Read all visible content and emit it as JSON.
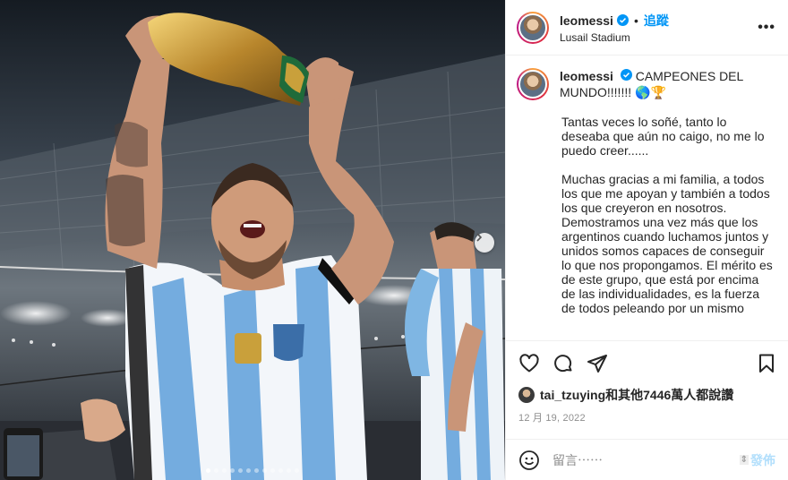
{
  "post": {
    "username": "leomessi",
    "follow_label": "追蹤",
    "separator": "•",
    "location": "Lusail Stadium",
    "more_label": "•••"
  },
  "caption": {
    "username": "leomessi",
    "first_line": "CAMPEONES DEL MUNDO!!!!!!!",
    "emojis": "🌎🏆",
    "paragraphs": [
      "Tantas veces lo soñé, tanto lo deseaba que aún no caigo, no me lo puedo creer......",
      "Muchas gracias a mi familia, a todos los que me apoyan y también a todos los que creyeron en nosotros. Demostramos una vez más que los argentinos cuando luchamos juntos y unidos somos capaces de conseguir lo que nos propongamos. El mérito es de este grupo, que está por encima de las individualidades, es la fuerza de todos peleando por un mismo"
    ]
  },
  "likes": {
    "liker": "tai_tzuying",
    "rest": "和其他7446萬人都說讚"
  },
  "date": "12 月 19, 2022",
  "comment": {
    "placeholder": "留言⋯⋯",
    "post_label": "發佈"
  },
  "icons": [
    "verified-icon",
    "more-icon",
    "heart-icon",
    "comment-icon",
    "share-icon",
    "save-icon",
    "emoji-icon",
    "chevron-right-icon"
  ],
  "colors": {
    "accent": "#0095f6",
    "verified": "#0095f6",
    "post_disabled": "#b2dffc",
    "text": "#262626",
    "muted": "#8e8e8e"
  },
  "carousel": {
    "slides": 12,
    "active": 1
  }
}
